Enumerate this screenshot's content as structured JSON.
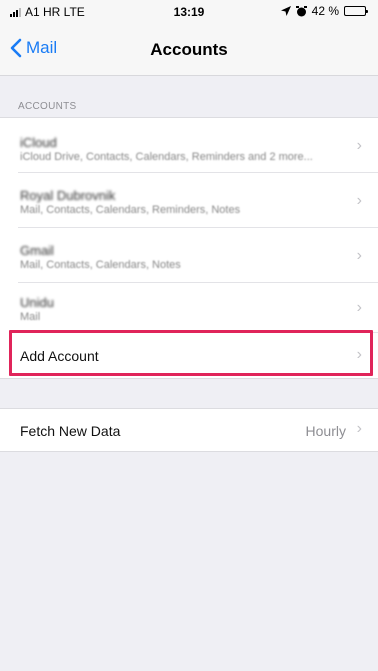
{
  "status_bar": {
    "carrier": "A1 HR  LTE",
    "time": "13:19",
    "battery_percent": "42 %",
    "battery_level": 0.42
  },
  "nav": {
    "back_label": "Mail",
    "title": "Accounts"
  },
  "accounts_section": {
    "header": "ACCOUNTS",
    "accounts": [
      {
        "name": "iCloud",
        "services": "iCloud Drive, Contacts, Calendars, Reminders and 2 more..."
      },
      {
        "name": "Royal Dubrovnik",
        "services": "Mail, Contacts, Calendars, Reminders, Notes"
      },
      {
        "name": "Gmail",
        "services": "Mail, Contacts, Calendars, Notes"
      },
      {
        "name": "Unidu",
        "services": "Mail"
      }
    ],
    "add_account_label": "Add Account"
  },
  "fetch": {
    "label": "Fetch New Data",
    "value": "Hourly"
  },
  "colors": {
    "accent": "#1a7cf5",
    "highlight": "#e0245a"
  }
}
